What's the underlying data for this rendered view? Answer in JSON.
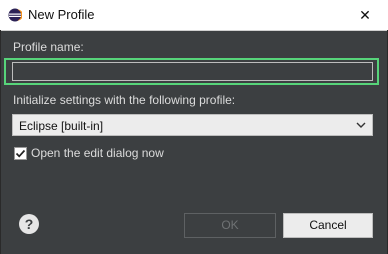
{
  "window": {
    "title": "New Profile",
    "close_glyph": "✕",
    "icon": "eclipse-icon"
  },
  "form": {
    "profile_name_label": "Profile name:",
    "profile_name_value": "",
    "init_label": "Initialize settings with the following profile:",
    "profile_select_value": "Eclipse [built-in]",
    "open_edit_dialog_label": "Open the edit dialog now",
    "open_edit_dialog_checked": true
  },
  "footer": {
    "help_glyph": "?",
    "ok_label": "OK",
    "cancel_label": "Cancel",
    "ok_enabled": false
  },
  "colors": {
    "focus_ring": "#57d47a",
    "background": "#3c3f41",
    "titlebar": "#ffffff"
  }
}
